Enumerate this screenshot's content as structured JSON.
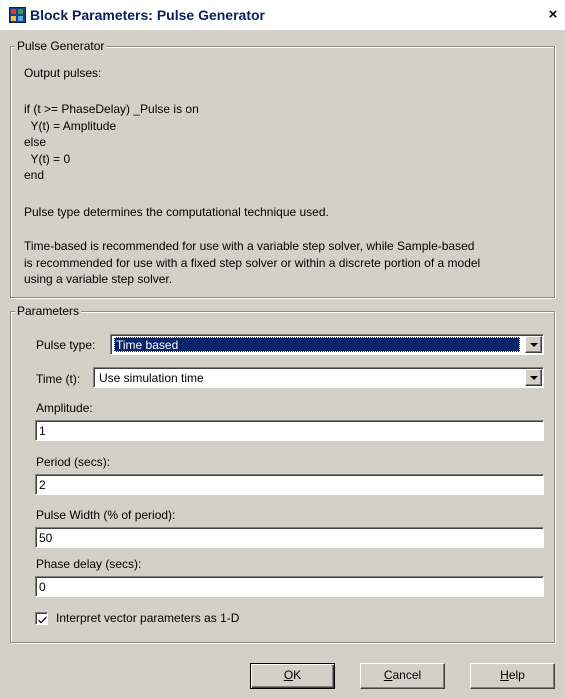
{
  "window": {
    "title": "Block Parameters: Pulse Generator",
    "close_glyph": "×"
  },
  "description_group": {
    "legend": "Pulse Generator",
    "lines": [
      "Output pulses:",
      "if (t >= PhaseDelay) _Pulse is on",
      "  Y(t) = Amplitude",
      "else",
      "  Y(t) = 0",
      "end",
      "Pulse type determines the computational technique used.",
      "Time-based is recommended for use with a variable step solver, while Sample-based",
      "is recommended for use with a fixed step solver or within a discrete portion of a model",
      "using a variable step solver."
    ]
  },
  "parameters_group": {
    "legend": "Parameters",
    "pulse_type": {
      "label": "Pulse type:",
      "value": "Time based"
    },
    "time": {
      "label": "Time (t):",
      "value": "Use simulation time"
    },
    "amplitude": {
      "label": "Amplitude:",
      "value": "1"
    },
    "period": {
      "label": "Period (secs):",
      "value": "2"
    },
    "pulse_width": {
      "label": "Pulse Width (% of period):",
      "value": "50"
    },
    "phase_delay": {
      "label": "Phase delay (secs):",
      "value": "0"
    },
    "interpret_vector": {
      "label": "Interpret vector parameters as 1-D",
      "checked": true
    }
  },
  "buttons": {
    "ok": {
      "mnemonic": "O",
      "rest": "K"
    },
    "cancel": {
      "mnemonic": "C",
      "rest": "ancel"
    },
    "help": {
      "mnemonic": "H",
      "rest": "elp"
    }
  },
  "icons": {
    "app": "simulink-block-icon",
    "close": "close-icon",
    "check": "checkmark-icon",
    "dropdown": "chevron-down-icon"
  }
}
